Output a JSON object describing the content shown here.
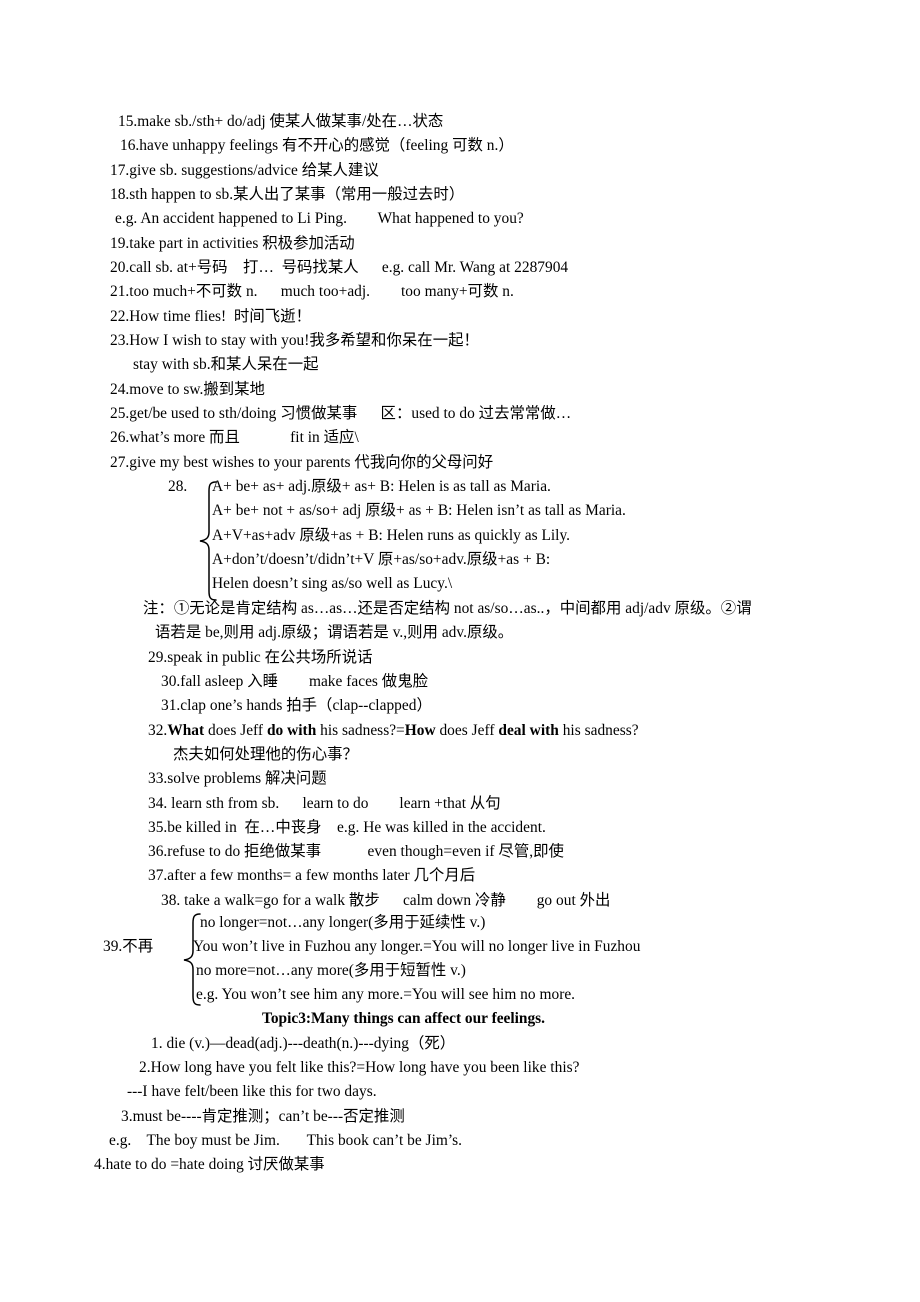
{
  "document": {
    "background_color": "#ffffff",
    "text_color": "#000000"
  },
  "lines": {
    "l15": "15.make sb./sth+ do/adj 使某人做某事/处在…状态",
    "l16": "16.have unhappy feelings 有不开心的感觉（feeling 可数 n.）",
    "l17": "17.give sb. suggestions/advice 给某人建议",
    "l18": "18.sth happen to sb.某人出了某事（常用一般过去时）",
    "l18eg": "e.g. An accident happened to Li Ping.        What happened to you?",
    "l19": "19.take part in activities 积极参加活动",
    "l20": "20.call sb. at+号码    打…  号码找某人      e.g. call Mr. Wang at 2287904",
    "l21": "21.too much+不可数 n.      much too+adj.        too many+可数 n.",
    "l22": "22.How time flies!  时间飞逝！",
    "l23": "23.How I wish to stay with you!我多希望和你呆在一起！",
    "l23b": "stay with sb.和某人呆在一起",
    "l24": "24.move to sw.搬到某地",
    "l25": "25.get/be used to sth/doing 习惯做某事      区：used to do 过去常常做…",
    "l26": "26.what’s more 而且             fit in 适应\\",
    "l27": "27.give my best wishes to your parents 代我向你的父母问好",
    "l28num": "28.",
    "l28a": "A+ be+ as+ adj.原级+ as+ B: Helen is as tall as Maria.",
    "l28b": "A+ be+ not + as/so+ adj 原级+ as + B: Helen isn’t as tall as Maria.",
    "l28c": "A+V+as+adv 原级+as + B: Helen runs as quickly as Lily.",
    "l28d": "A+don’t/doesn’t/didn’t+V 原+as/so+adv.原级+as + B:",
    "l28e": "Helen doesn’t sing as/so well as Lucy.\\",
    "note1": "注：①无论是肯定结构 as…as…还是否定结构 not as/so…as..，中间都用 adj/adv 原级。②谓",
    "note2": "语若是 be,则用 adj.原级；谓语若是 v.,则用 adv.原级。",
    "l29": "29.speak in public 在公共场所说话",
    "l30": "30.fall asleep 入睡        make faces 做鬼脸",
    "l31": "31.clap one’s hands 拍手（clap--clapped）",
    "l32num": "32.",
    "l32_b1": "What",
    "l32_t1": " does Jeff ",
    "l32_b2": "do with",
    "l32_t2": " his sadness?=",
    "l32_b3": "How",
    "l32_t3": " does Jeff ",
    "l32_b4": "deal with",
    "l32_t4": " his sadness?",
    "l32cn": "杰夫如何处理他的伤心事？",
    "l33": "33.solve problems 解决问题",
    "l34": "34. learn sth from sb.      learn to do        learn +that 从句",
    "l35": "35.be killed in  在…中丧身    e.g. He was killed in the accident.",
    "l36": "36.refuse to do 拒绝做某事            even though=even if 尽管,即使",
    "l37": "37.after a few months= a few months later 几个月后",
    "l38": "38. take a walk=go for a walk 散步      calm down 冷静        go out 外出",
    "l39num": "39.不再",
    "l39a": "no longer=not…any longer(多用于延续性 v.)",
    "l39b": "You won’t live in Fuzhou any longer.=You will no longer live in Fuzhou",
    "l39c": "no more=not…any more(多用于短暂性 v.)",
    "l39d": "e.g. You won’t see him any more.=You will see him no more.",
    "topic3": "Topic3:Many things can affect our feelings.",
    "t1": "1. die (v.)—dead(adj.)---death(n.)---dying（死）",
    "t2": "2.How long have you felt like this?=How long have you been like this?",
    "t2b": "---I have felt/been like this for two days.",
    "t3": "3.must be----肯定推测；can’t be---否定推测",
    "t3eg": "e.g.    The boy must be Jim.       This book can’t be Jim’s.",
    "t4": "4.hate to do =hate doing 讨厌做某事"
  }
}
